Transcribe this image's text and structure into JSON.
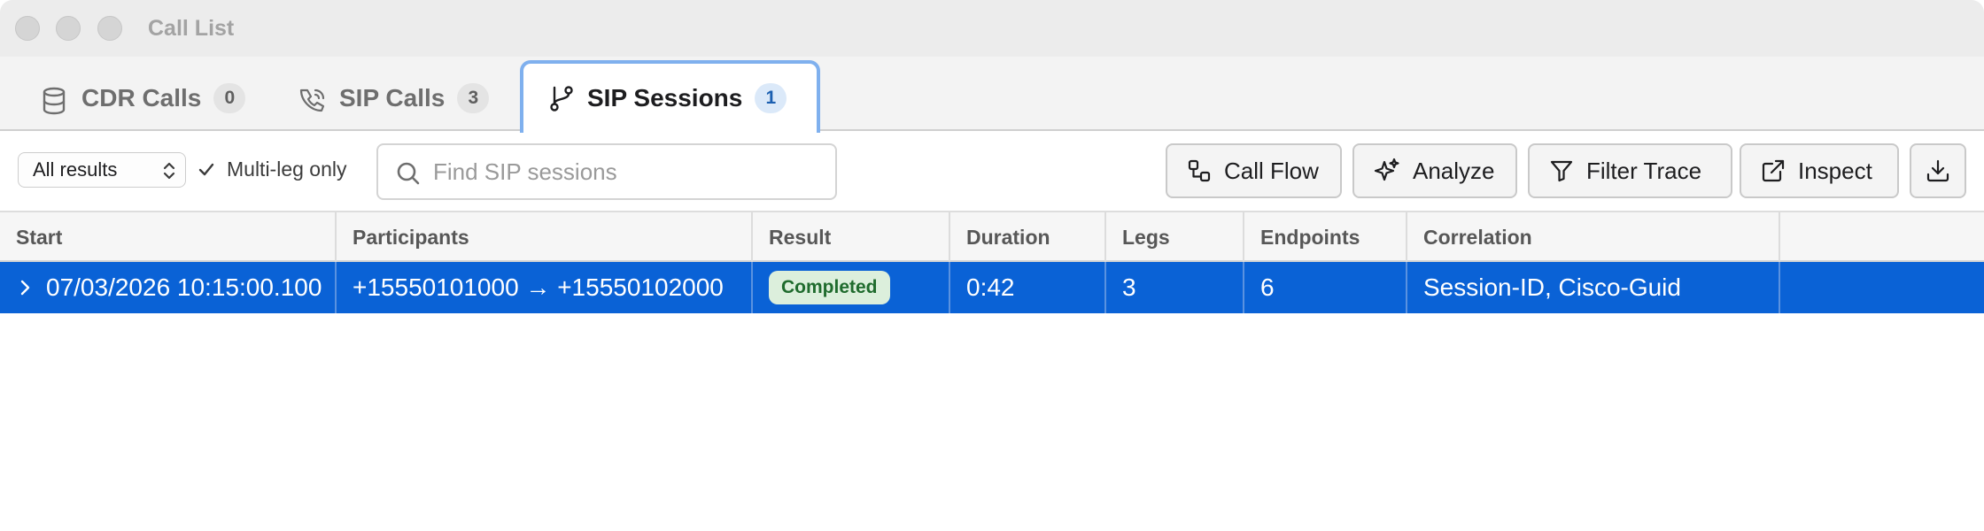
{
  "window": {
    "title": "Call List"
  },
  "tabs": [
    {
      "label": "CDR Calls",
      "count": "0"
    },
    {
      "label": "SIP Calls",
      "count": "3"
    },
    {
      "label": "SIP Sessions",
      "count": "1"
    }
  ],
  "toolbar": {
    "results_select": "All results",
    "multileg_label": "Multi-leg only",
    "multileg_checked": true,
    "search_placeholder": "Find SIP sessions",
    "search_value": "",
    "buttons": {
      "call_flow": "Call Flow",
      "analyze": "Analyze",
      "filter_trace": "Filter Trace",
      "inspect": "Inspect"
    }
  },
  "table": {
    "columns": [
      "Start",
      "Participants",
      "Result",
      "Duration",
      "Legs",
      "Endpoints",
      "Correlation",
      ""
    ],
    "rows": [
      {
        "start": "07/03/2026 10:15:00.100",
        "participants": "+15550101000 → +15550102000",
        "result": "Completed",
        "duration": "0:42",
        "legs": "3",
        "endpoints": "6",
        "correlation": "Session-ID, Cisco-Guid",
        "selected": true
      }
    ]
  },
  "colors": {
    "selection": "#0a62d6",
    "active_tab_border": "#7fb0ee",
    "status_completed_bg": "#dcefdc",
    "status_completed_text": "#1f6b2d"
  }
}
